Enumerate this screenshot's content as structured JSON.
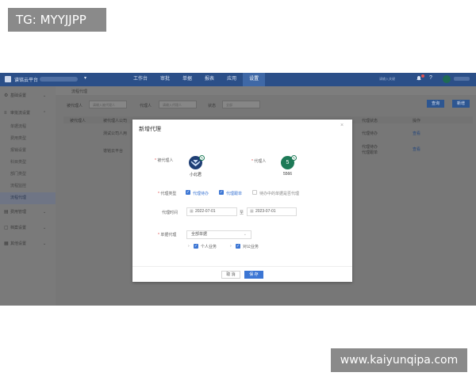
{
  "watermarks": {
    "top": "TG: MYYJJPP",
    "bottom": "www.kaiyunqipa.com"
  },
  "topbar": {
    "brand": "谱铭云平台",
    "nav": [
      "工作台",
      "审批",
      "单据",
      "报表",
      "应用",
      "设置"
    ],
    "search_placeholder": "请输入关键",
    "help_icon": "?",
    "dropdown_icon": "▾"
  },
  "sidebar": {
    "groups": [
      {
        "icon": "⚙",
        "label": "基础设置",
        "arrow": "⌄"
      },
      {
        "icon": "≡",
        "label": "审批流设置",
        "arrow": "⌃"
      },
      {
        "icon": "▤",
        "label": "费用管理",
        "arrow": "⌄"
      },
      {
        "icon": "▢",
        "label": "档案设置",
        "arrow": "⌄"
      },
      {
        "icon": "▦",
        "label": "其他设置",
        "arrow": "⌄"
      }
    ],
    "sub_items": [
      "单据流程",
      "费用类型",
      "报销设置",
      "科目类型",
      "部门类型",
      "流程监控",
      "流程代理"
    ]
  },
  "content": {
    "breadcrumb": "流程代理",
    "filters": {
      "agent_label": "被代理人",
      "agent_placeholder": "请输入被代理人",
      "proxy_label": "代理人",
      "proxy_placeholder": "请输入代理人",
      "status_label": "状态",
      "status_value": "全部"
    },
    "query_button": "查询",
    "add_button": "新增",
    "table": {
      "headers": [
        "被代理人",
        "被代理人公司",
        "代理状态",
        "操作"
      ],
      "rows": [
        {
          "col2": "测试公司人用",
          "status": "代理待办",
          "action": "查看"
        },
        {
          "col2": "谱铭云平台",
          "status": "代理待办\n代理跟单",
          "action": "查看"
        }
      ]
    }
  },
  "dialog": {
    "title": "新增代理",
    "close_icon": "×",
    "required_mark": "*",
    "agent_label": "被代理人",
    "agent_name": "小北君",
    "proxy_label": "代理人",
    "proxy_avatar_text": "5",
    "proxy_name": "5566",
    "type_label": "代理类型",
    "types": [
      {
        "label": "代理待办",
        "checked": true
      },
      {
        "label": "代理跟单",
        "checked": true
      },
      {
        "label": "待办中的单据是否代理",
        "checked": false
      }
    ],
    "time_label": "代理时间",
    "start_date": "2022-07-01",
    "date_sep": "至",
    "end_date": "2023-07-01",
    "doc_label": "单据代理",
    "doc_select": "全部单据",
    "doc_options": [
      {
        "label": "个人业务",
        "checked": true
      },
      {
        "label": "对公业务",
        "checked": true
      }
    ],
    "cancel_button": "取 消",
    "save_button": "保 存"
  },
  "colors": {
    "topbar": "#2b4f88",
    "primary": "#3c76d4",
    "overlay": "#7f7f7f"
  }
}
